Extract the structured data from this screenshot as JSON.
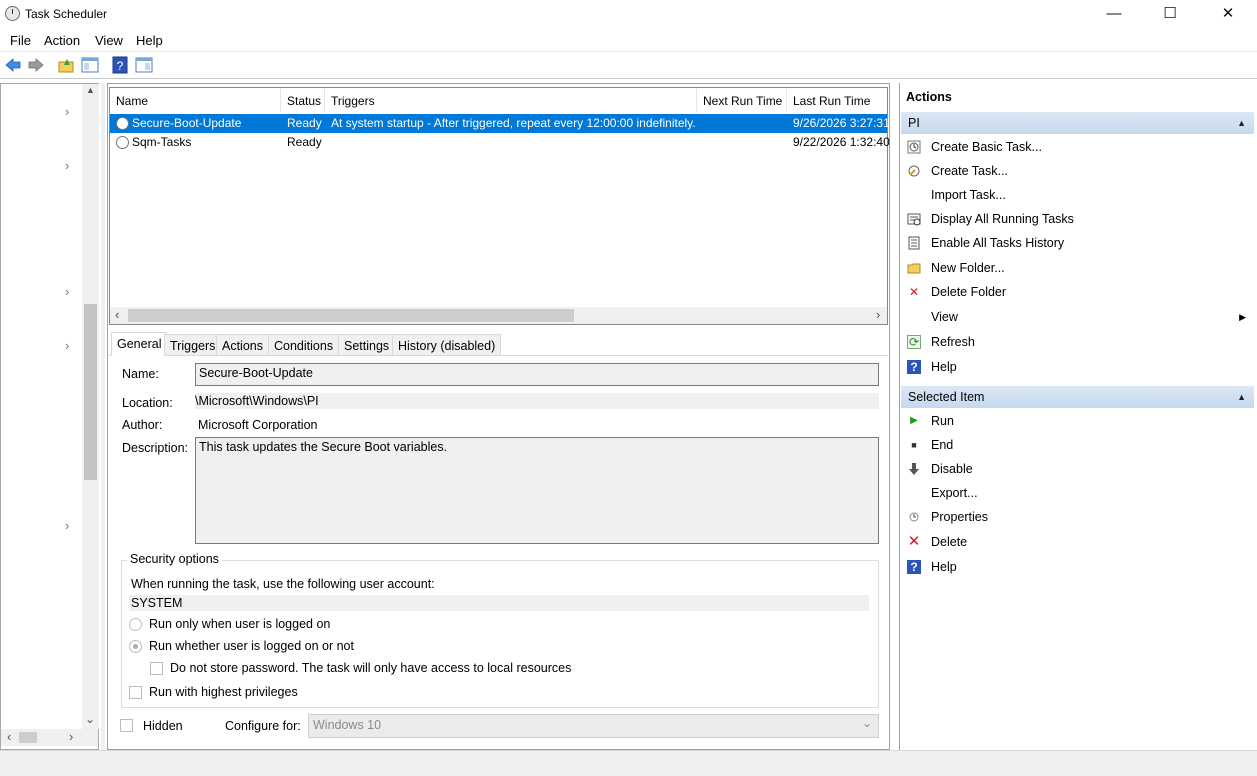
{
  "window": {
    "title": "Task Scheduler",
    "minimize_glyph": "—",
    "maximize_glyph": "☐",
    "close_glyph": "✕"
  },
  "menu": [
    "File",
    "Action",
    "View",
    "Help"
  ],
  "toolbar": {
    "icons": [
      "back-arrow-icon",
      "forward-arrow-icon",
      "up-folder-icon",
      "show-hide-tree-icon",
      "help-icon",
      "show-hide-action-pane-icon"
    ]
  },
  "tree": {
    "chevron": "›",
    "scroll_down": "⌄",
    "scroll_left": "‹",
    "scroll_right": "›"
  },
  "task_list": {
    "columns": [
      "Name",
      "Status",
      "Triggers",
      "Next Run Time",
      "Last Run Time"
    ],
    "rows": [
      {
        "name": "Secure-Boot-Update",
        "status": "Ready",
        "triggers": "At system startup - After triggered, repeat every 12:00:00 indefinitely.",
        "next_run": "",
        "last_run": "9/26/2026 3:27:31"
      },
      {
        "name": "Sqm-Tasks",
        "status": "Ready",
        "triggers": "",
        "next_run": "",
        "last_run": "9/22/2026 1:32:40"
      }
    ],
    "scroll_left": "‹",
    "scroll_right": "›"
  },
  "details": {
    "tabs": [
      "General",
      "Triggers",
      "Actions",
      "Conditions",
      "Settings",
      "History (disabled)"
    ],
    "name_label": "Name:",
    "name_value": "Secure-Boot-Update",
    "location_label": "Location:",
    "location_value": "\\Microsoft\\Windows\\PI",
    "author_label": "Author:",
    "author_value": "Microsoft Corporation",
    "description_label": "Description:",
    "description_value": "This task updates the Secure Boot variables.",
    "security": {
      "title": "Security options",
      "account_prompt": "When running the task, use the following user account:",
      "account_value": "SYSTEM",
      "option_logged_on": "Run only when user is logged on",
      "option_whether": "Run whether user is logged on or not",
      "option_no_password": "Do not store password.  The task will only have access to local resources",
      "option_highest": "Run with highest privileges"
    },
    "hidden_label": "Hidden",
    "configure_label": "Configure for:",
    "configure_value": "Windows 10",
    "configure_arrow": "⌄"
  },
  "actions": {
    "header": "Actions",
    "section1": "PI",
    "section1_items": [
      {
        "label": "Create Basic Task...",
        "icon": "create-basic-task-icon"
      },
      {
        "label": "Create Task...",
        "icon": "create-task-icon"
      },
      {
        "label": "Import Task...",
        "icon": ""
      },
      {
        "label": "Display All Running Tasks",
        "icon": "running-tasks-icon"
      },
      {
        "label": "Enable All Tasks History",
        "icon": "tasks-history-icon"
      },
      {
        "label": "New Folder...",
        "icon": "new-folder-icon"
      },
      {
        "label": "Delete Folder",
        "icon": "delete-folder-icon"
      },
      {
        "label": "View",
        "icon": ""
      },
      {
        "label": "Refresh",
        "icon": "refresh-icon"
      },
      {
        "label": "Help",
        "icon": "help-icon"
      }
    ],
    "section2": "Selected Item",
    "section2_items": [
      {
        "label": "Run",
        "icon": "run-icon"
      },
      {
        "label": "End",
        "icon": "end-icon"
      },
      {
        "label": "Disable",
        "icon": "disable-icon"
      },
      {
        "label": "Export...",
        "icon": ""
      },
      {
        "label": "Properties",
        "icon": "properties-icon"
      },
      {
        "label": "Delete",
        "icon": "delete-icon"
      },
      {
        "label": "Help",
        "icon": "help-icon"
      }
    ],
    "collapse_glyph": "▲",
    "submenu_glyph": "▶"
  },
  "glyphs": {
    "question": "?",
    "x": "✕",
    "play": "▶",
    "square": "■",
    "down": "🡇",
    "refresh": "⟳"
  },
  "colors": {
    "selection": "#0078d7",
    "section_header": "#c5d9ee"
  }
}
